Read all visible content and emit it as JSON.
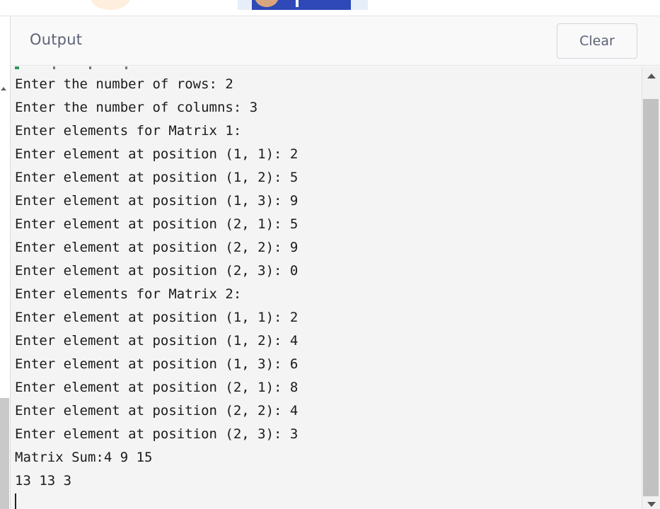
{
  "header": {
    "title": "Output",
    "clear_label": "Clear"
  },
  "console": {
    "lines": [
      "Enter the number of rows: 2",
      "Enter the number of columns: 3",
      "Enter elements for Matrix 1:",
      "Enter element at position (1, 1): 2",
      "Enter element at position (1, 2): 5",
      "Enter element at position (1, 3): 9",
      "Enter element at position (2, 1): 5",
      "Enter element at position (2, 2): 9",
      "Enter element at position (2, 3): 0",
      "Enter elements for Matrix 2:",
      "Enter element at position (1, 1): 2",
      "Enter element at position (1, 2): 4",
      "Enter element at position (1, 3): 6",
      "Enter element at position (2, 1): 8",
      "Enter element at position (2, 2): 4",
      "Enter element at position (2, 3): 3",
      "Matrix Sum:4 9 15",
      "13 13 3"
    ]
  },
  "icons": {
    "scroll_up": "triangle-up-icon",
    "scroll_down": "triangle-down-icon"
  },
  "colors": {
    "header_text": "#5d6275",
    "console_bg": "#f4f4f4",
    "console_text": "#1b1b1b",
    "scroll_thumb": "#c1c1c1"
  }
}
